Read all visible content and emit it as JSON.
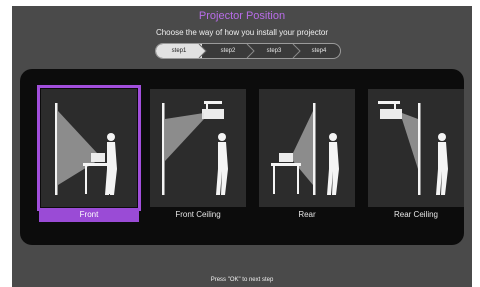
{
  "header": {
    "title": "Projector Position",
    "subtitle": "Choose the way of how you install your projector"
  },
  "steps": [
    {
      "label": "step1",
      "active": true
    },
    {
      "label": "step2",
      "active": false
    },
    {
      "label": "step3",
      "active": false
    },
    {
      "label": "step4",
      "active": false
    }
  ],
  "options": [
    {
      "label": "Front",
      "selected": true
    },
    {
      "label": "Front Ceiling",
      "selected": false
    },
    {
      "label": "Rear",
      "selected": false
    },
    {
      "label": "Rear Ceiling",
      "selected": false
    }
  ],
  "footer": {
    "hint": "Press \"OK\" to next step"
  },
  "colors": {
    "accent": "#a24fdc",
    "background": "#4a4a4a",
    "panel": "#0c0c0c"
  }
}
